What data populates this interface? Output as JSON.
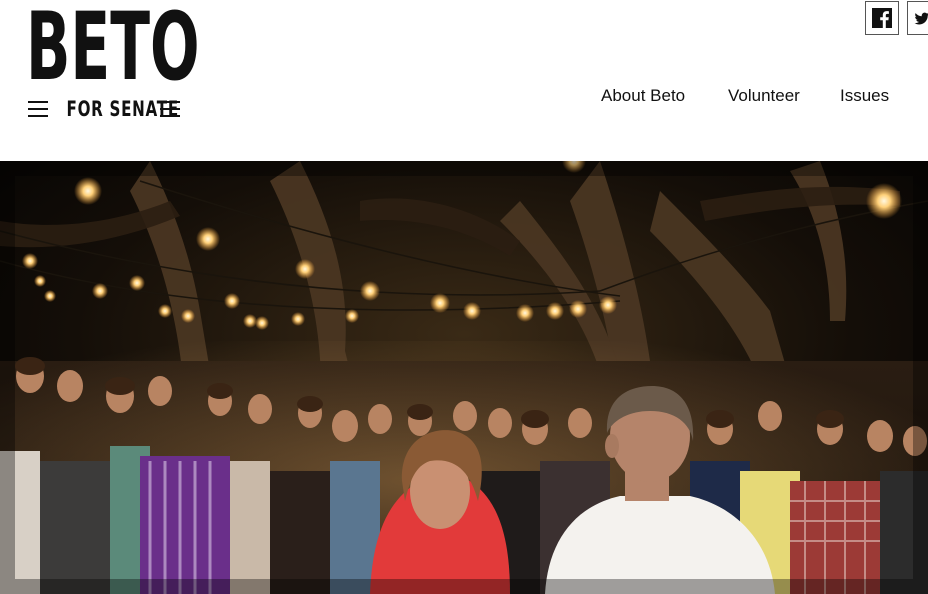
{
  "logo": {
    "main": "BETO",
    "sub": "FOR SENATE"
  },
  "social": {
    "facebook_icon": "facebook-icon",
    "twitter_icon": "twitter-icon"
  },
  "nav": {
    "items": [
      {
        "label": "About Beto"
      },
      {
        "label": "Volunteer"
      },
      {
        "label": "Issues"
      }
    ]
  },
  "hero": {
    "description_icon": "photo-outdoor-evening-gathering"
  },
  "colors": {
    "text": "#111111",
    "background": "#ffffff",
    "hero_dark": "#0b0906"
  }
}
